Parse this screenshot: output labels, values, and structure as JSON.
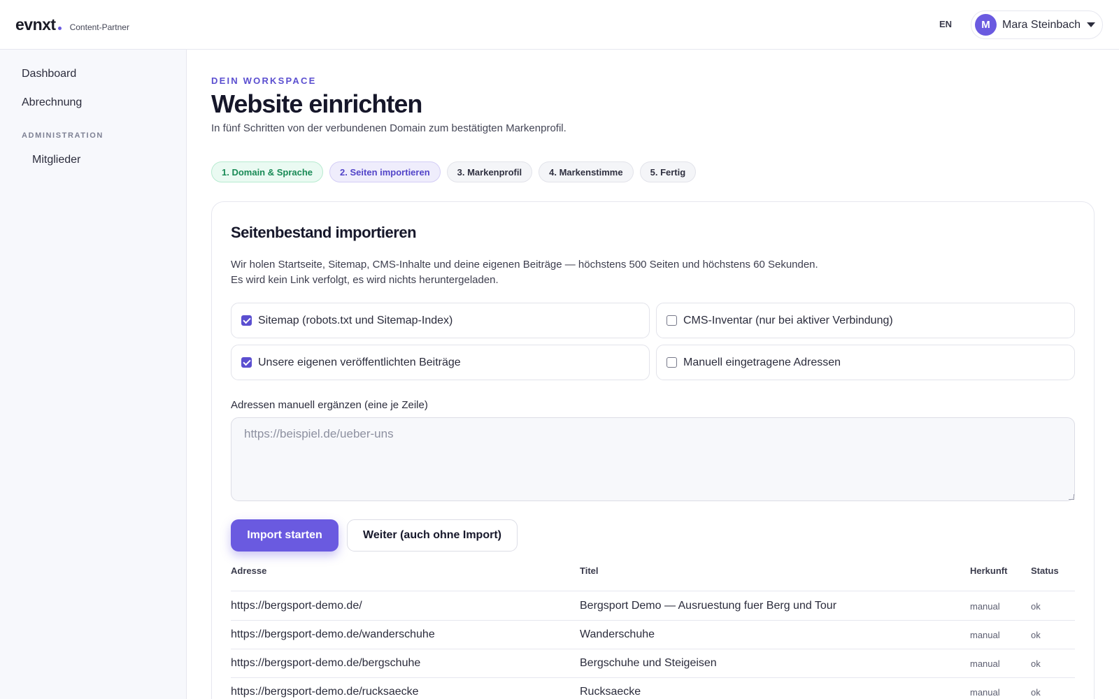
{
  "header": {
    "logo": "evnxt",
    "logo_sub": "Content-Partner",
    "lang": "EN",
    "user_initial": "M",
    "user_name": "Mara Steinbach"
  },
  "sidebar": {
    "items": [
      {
        "label": "Dashboard"
      },
      {
        "label": "Abrechnung"
      }
    ],
    "section_label": "ADMINISTRATION",
    "sub_items": [
      {
        "label": "Mitglieder"
      }
    ]
  },
  "page": {
    "eyebrow": "DEIN WORKSPACE",
    "title": "Website einrichten",
    "subtitle": "In fünf Schritten von der verbundenen Domain zum bestätigten Markenprofil."
  },
  "steps": [
    {
      "label": "1. Domain & Sprache",
      "state": "done"
    },
    {
      "label": "2. Seiten importieren",
      "state": "active"
    },
    {
      "label": "3. Markenprofil",
      "state": "pending"
    },
    {
      "label": "4. Markenstimme",
      "state": "pending"
    },
    {
      "label": "5. Fertig",
      "state": "pending"
    }
  ],
  "card": {
    "title": "Seitenbestand importieren",
    "description": "Wir holen Startseite, Sitemap, CMS-Inhalte und deine eigenen Beiträge — höchstens 500 Seiten und höchstens 60 Sekunden. Es wird kein Link verfolgt, es wird nichts heruntergeladen.",
    "options": [
      {
        "label": "Sitemap (robots.txt und Sitemap-Index)",
        "checked": true
      },
      {
        "label": "CMS-Inventar (nur bei aktiver Verbindung)",
        "checked": false
      },
      {
        "label": "Unsere eigenen veröffentlichten Beiträge",
        "checked": true
      },
      {
        "label": "Manuell eingetragene Adressen",
        "checked": false
      }
    ],
    "manual_label": "Adressen manuell ergänzen (eine je Zeile)",
    "manual_placeholder": "https://beispiel.de/ueber-uns",
    "manual_value": "",
    "primary_button": "Import starten",
    "secondary_button": "Weiter (auch ohne Import)"
  },
  "table": {
    "columns": [
      "Adresse",
      "Titel",
      "Herkunft",
      "Status"
    ],
    "rows": [
      {
        "address": "https://bergsport-demo.de/",
        "title": "Bergsport Demo — Ausruestung fuer Berg und Tour",
        "origin": "manual",
        "status": "ok"
      },
      {
        "address": "https://bergsport-demo.de/wanderschuhe",
        "title": "Wanderschuhe",
        "origin": "manual",
        "status": "ok"
      },
      {
        "address": "https://bergsport-demo.de/bergschuhe",
        "title": "Bergschuhe und Steigeisen",
        "origin": "manual",
        "status": "ok"
      },
      {
        "address": "https://bergsport-demo.de/rucksaecke",
        "title": "Rucksaecke",
        "origin": "manual",
        "status": "ok"
      }
    ]
  },
  "colors": {
    "accent": "#6a5ae0",
    "step_done": "#198a56",
    "step_active": "#5244c8"
  }
}
